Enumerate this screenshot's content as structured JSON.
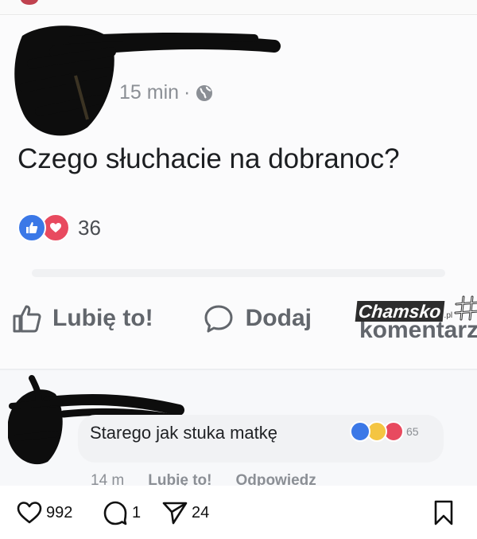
{
  "post": {
    "time": "15 min",
    "separator": "·",
    "text": "Czego słuchacie na dobranoc?",
    "reaction_count": "36",
    "actions": {
      "like": "Lubię to!",
      "comment_prefix": "Dodaj",
      "comment_overflow": "komentarz"
    },
    "watermark": {
      "brand": "Chamsko",
      "tld": ".pl"
    }
  },
  "comment": {
    "text": "Starego jak stuka matkę",
    "reaction_count": "65",
    "time": "14 m",
    "like": "Lubię to!",
    "reply": "Odpowiedz"
  },
  "instagram_bar": {
    "likes": "992",
    "comments": "1",
    "shares": "24"
  },
  "icons": {
    "globe": "globe-icon",
    "like": "thumbs-up-icon",
    "love": "heart-icon",
    "comment": "speech-bubble-icon",
    "ig_like": "heart-outline-icon",
    "ig_comment": "comment-outline-icon",
    "ig_share": "paper-plane-icon",
    "ig_save": "bookmark-icon"
  },
  "colors": {
    "like_blue": "#3b78e7",
    "love_red": "#e84a5f",
    "text_dark": "#1c1e21",
    "text_grey": "#8b8f95"
  }
}
